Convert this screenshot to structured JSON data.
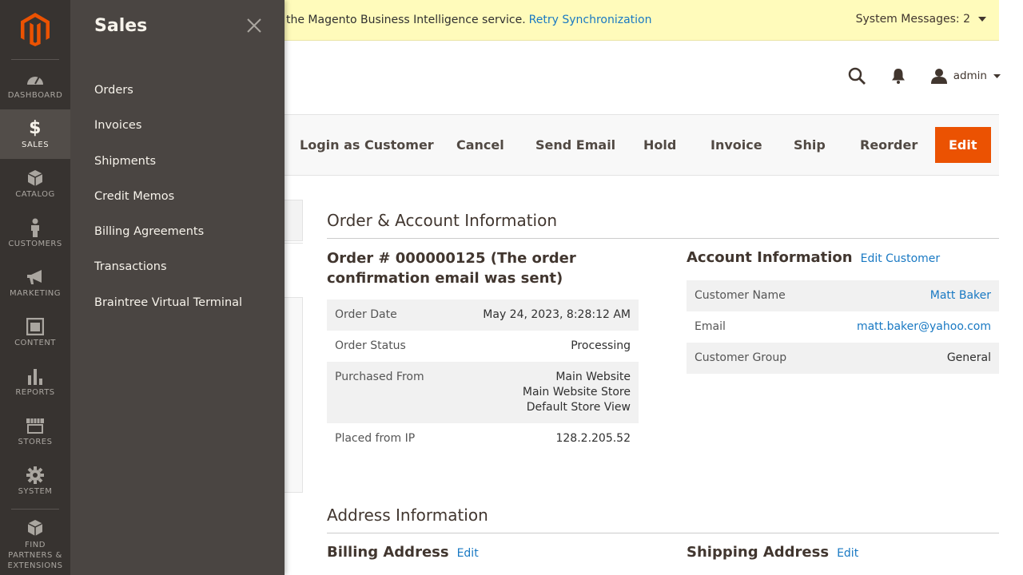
{
  "nav": {
    "items": [
      {
        "label": "DASHBOARD",
        "icon": "dashboard-icon"
      },
      {
        "label": "SALES",
        "icon": "dollar-icon"
      },
      {
        "label": "CATALOG",
        "icon": "box-icon"
      },
      {
        "label": "CUSTOMERS",
        "icon": "person-icon"
      },
      {
        "label": "MARKETING",
        "icon": "megaphone-icon"
      },
      {
        "label": "CONTENT",
        "icon": "layout-icon"
      },
      {
        "label": "REPORTS",
        "icon": "bar-chart-icon"
      },
      {
        "label": "STORES",
        "icon": "storefront-icon"
      },
      {
        "label": "SYSTEM",
        "icon": "gear-icon"
      },
      {
        "label": "FIND PARTNERS & EXTENSIONS",
        "icon": "cubes-icon"
      }
    ]
  },
  "flyout": {
    "title": "Sales",
    "items": [
      "Orders",
      "Invoices",
      "Shipments",
      "Credit Memos",
      "Billing Agreements",
      "Transactions",
      "Braintree Virtual Terminal"
    ]
  },
  "system_bar": {
    "message": "the Magento Business Intelligence service.",
    "link": "Retry Synchronization",
    "count_label": "System Messages: 2"
  },
  "header": {
    "user": "admin"
  },
  "toolbar": {
    "login_as_customer": "Login as Customer",
    "cancel": "Cancel",
    "send_email": "Send Email",
    "hold": "Hold",
    "invoice": "Invoice",
    "ship": "Ship",
    "reorder": "Reorder",
    "edit": "Edit"
  },
  "order_account": {
    "section_title": "Order & Account Information",
    "order_title": "Order # 000000125 (The order confirmation email was sent)",
    "order": {
      "date_label": "Order Date",
      "date": "May 24, 2023, 8:28:12 AM",
      "status_label": "Order Status",
      "status": "Processing",
      "purchased_label": "Purchased From",
      "purchased_lines": [
        "Main Website",
        "Main Website Store",
        "Default Store View"
      ],
      "ip_label": "Placed from IP",
      "ip": "128.2.205.52"
    },
    "account": {
      "title": "Account Information",
      "edit_link": "Edit Customer",
      "name_label": "Customer Name",
      "name": "Matt Baker",
      "email_label": "Email",
      "email": "matt.baker@yahoo.com",
      "group_label": "Customer Group",
      "group": "General"
    }
  },
  "address": {
    "section_title": "Address Information",
    "billing_title": "Billing Address",
    "billing_edit": "Edit",
    "shipping_title": "Shipping Address",
    "shipping_edit": "Edit"
  }
}
